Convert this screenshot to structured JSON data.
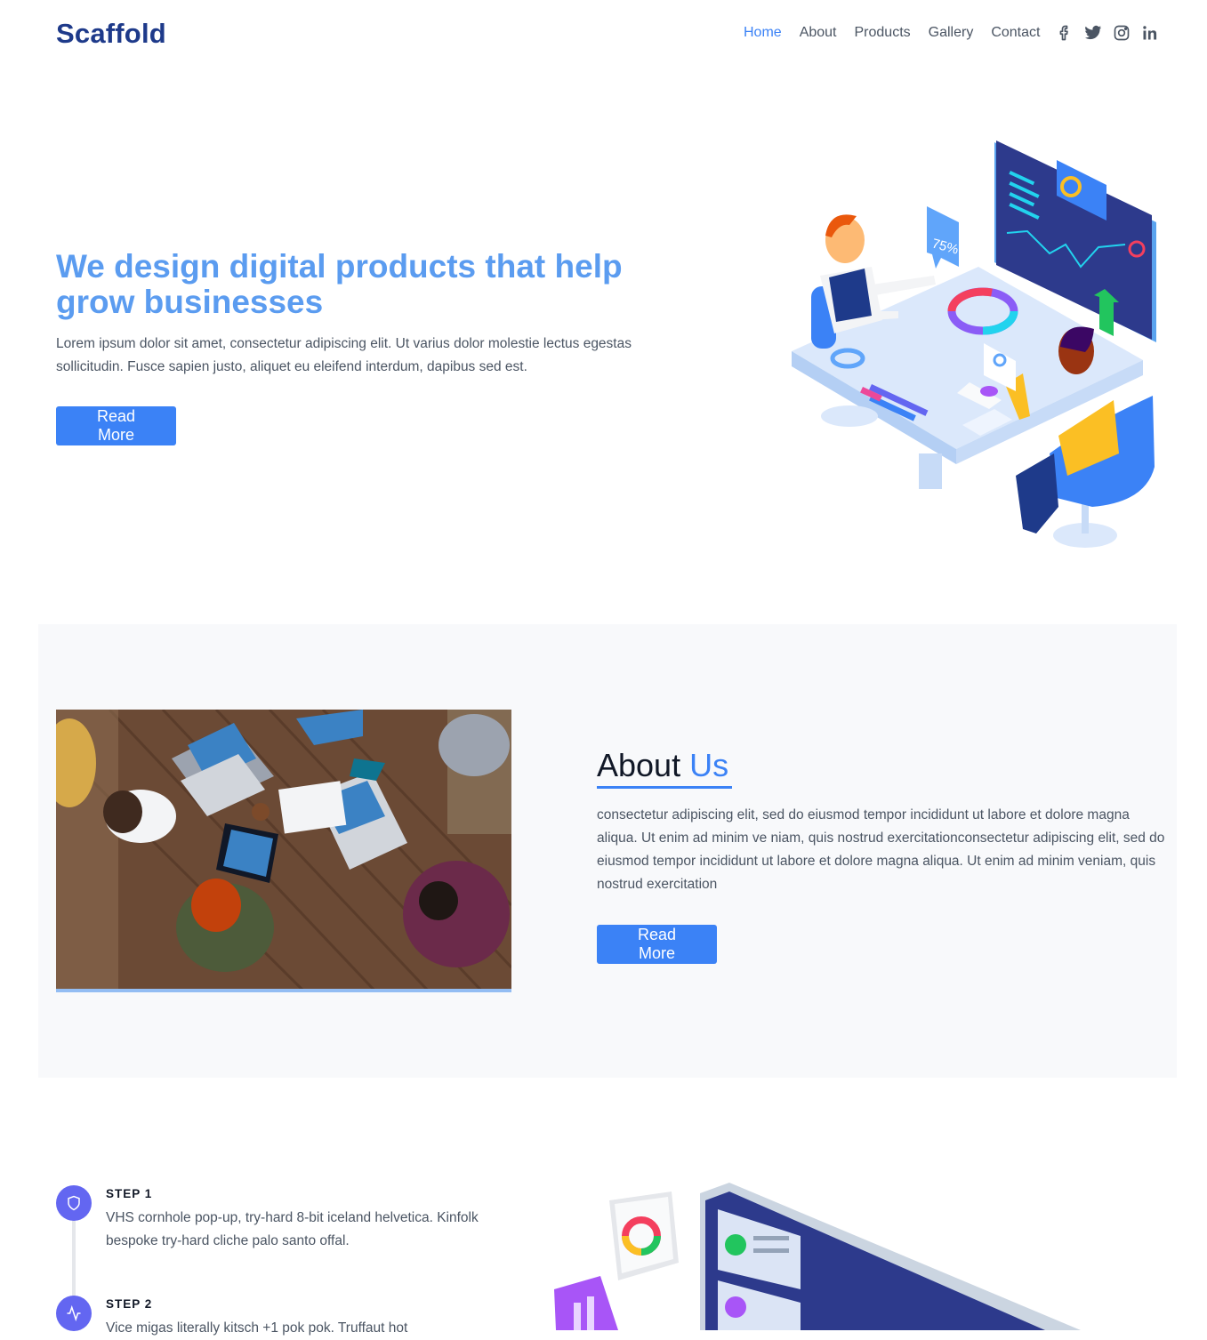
{
  "header": {
    "logo": "Scaffold",
    "nav": [
      "Home",
      "About",
      "Products",
      "Gallery",
      "Contact"
    ],
    "social": [
      "facebook-icon",
      "twitter-icon",
      "instagram-icon",
      "linkedin-icon"
    ]
  },
  "hero": {
    "title": "We design digital products that help grow businesses",
    "text": "Lorem ipsum dolor sit amet, consectetur adipiscing elit. Ut varius dolor molestie lectus egestas sollicitudin. Fusce sapien justo, aliquet eu eleifend interdum, dapibus sed est.",
    "button": "Read More",
    "illustration_badge": "75%"
  },
  "about": {
    "title_main": "About",
    "title_accent": "Us",
    "text": "consectetur adipiscing elit, sed do eiusmod tempor incididunt ut labore et dolore magna aliqua. Ut enim ad minim ve niam, quis nostrud exercitationconsectetur adipiscing elit, sed do eiusmod tempor incididunt ut labore et dolore magna aliqua. Ut enim ad minim veniam, quis nostrud exercitation",
    "button": "Read More"
  },
  "steps": [
    {
      "label": "STEP 1",
      "text": "VHS cornhole pop-up, try-hard 8-bit iceland helvetica. Kinfolk bespoke try-hard cliche palo santo offal.",
      "icon": "shield-icon"
    },
    {
      "label": "STEP 2",
      "text": "Vice migas literally kitsch +1 pok pok. Truffaut hot",
      "icon": "activity-icon"
    }
  ],
  "colors": {
    "accent": "#3b82f6",
    "logo": "#1e3a8a",
    "hero_title": "#5b9cf0",
    "step_circle": "#6366f1"
  }
}
